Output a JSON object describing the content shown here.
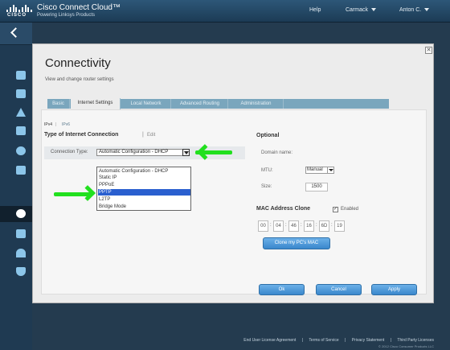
{
  "header": {
    "app_title": "Cisco Connect Cloud™",
    "app_subtitle": "Powering Linksys Products",
    "logo_text": "CISCO",
    "help": "Help",
    "location": "Carmack",
    "user": "Anton C."
  },
  "sidebar": {
    "icons": [
      "back-icon",
      "router-icon",
      "device-list-icon",
      "alert-icon",
      "parental-controls-icon",
      "speed-icon",
      "external-storage-icon",
      "settings-gear-icon",
      "camera-icon",
      "wifi-icon",
      "security-shield-icon"
    ],
    "active": "settings-gear-icon"
  },
  "dialog": {
    "title": "Connectivity",
    "subtitle": "View and change router settings",
    "close": "✕",
    "tabs": [
      {
        "label": "Basic"
      },
      {
        "label": "Internet Settings"
      },
      {
        "label": "Local Network"
      },
      {
        "label": "Advanced Routing"
      },
      {
        "label": "Administration"
      }
    ],
    "active_tab": "Internet Settings",
    "ipv4": "IPv4",
    "ipv6": "IPv6",
    "separator": "|"
  },
  "internet": {
    "heading": "Type of Internet Connection",
    "edit": "Edit",
    "separator": "|",
    "type_label": "Connection Type:",
    "type_value": "Automatic Configuration - DHCP",
    "options": [
      "Automatic Configuration - DHCP",
      "Static IP",
      "PPPoE",
      "PPTP",
      "L2TP",
      "Bridge Mode"
    ],
    "highlighted_option": "PPTP"
  },
  "optional": {
    "heading": "Optional",
    "domain_label": "Domain name:",
    "mtu_label": "MTU:",
    "mtu_value": "Manual",
    "size_label": "Size:",
    "size_value": "1500"
  },
  "mac_clone": {
    "heading": "MAC Address Clone",
    "enabled_label": "Enabled",
    "enabled": true,
    "fields": [
      "00",
      "04",
      "46",
      "16",
      "6D",
      "19"
    ],
    "clone_button": "Clone my PC's MAC"
  },
  "buttons": {
    "ok": "Ok",
    "cancel": "Cancel",
    "apply": "Apply"
  },
  "footer": {
    "eula": "End User License Agreement",
    "terms": "Terms of Service",
    "privacy": "Privacy Statement",
    "third_party": "Third Party Licenses",
    "sep": "|",
    "copyright": "© 2012 Cisco Consumer Products LLC"
  },
  "annotation_color": "#22e01f"
}
